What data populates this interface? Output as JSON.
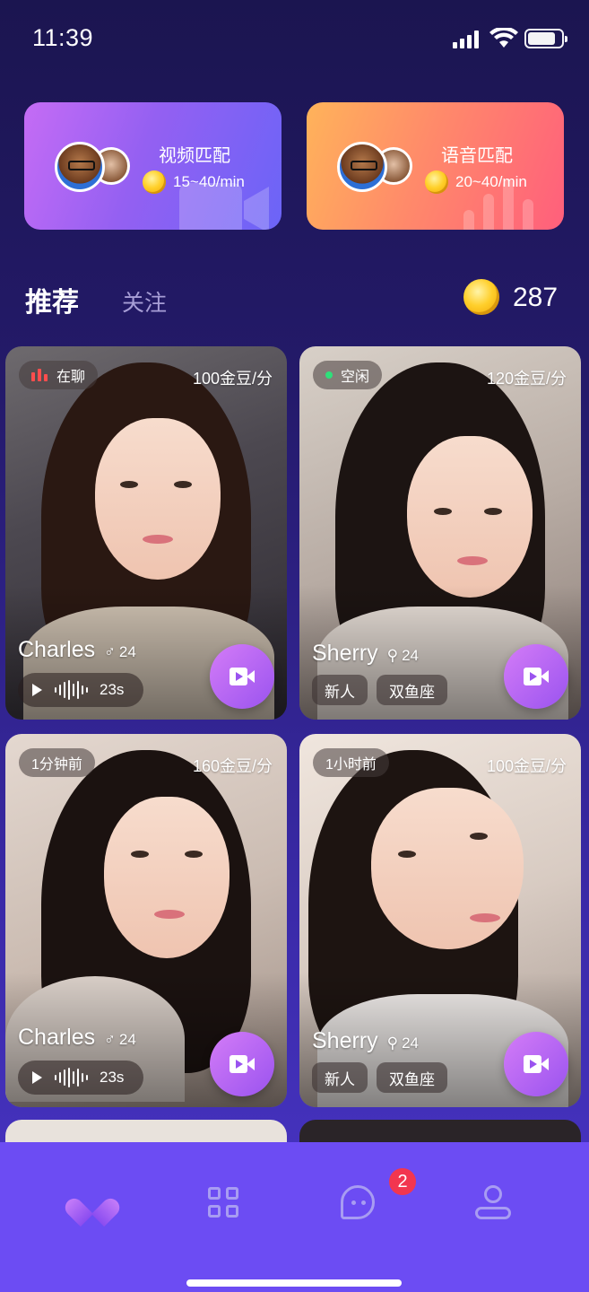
{
  "status_bar": {
    "time": "11:39"
  },
  "match_cards": [
    {
      "title": "视频匹配",
      "price": "15~40/min"
    },
    {
      "title": "语音匹配",
      "price": "20~40/min"
    }
  ],
  "tabs": {
    "recommend": "推荐",
    "follow": "关注"
  },
  "balance": {
    "value": "287"
  },
  "users": [
    {
      "status": "在聊",
      "status_type": "busy",
      "rate": "100金豆/分",
      "name": "Charles",
      "gender_icon": "male-icon",
      "gender_symbol": "♂",
      "age": "24",
      "voice_duration": "23s",
      "tags": []
    },
    {
      "status": "空闲",
      "status_type": "idle",
      "rate": "120金豆/分",
      "name": "Sherry",
      "gender_icon": "female-icon",
      "gender_symbol": "⚲",
      "age": "24",
      "tags": [
        "新人",
        "双鱼座"
      ]
    },
    {
      "status": "1分钟前",
      "status_type": "time",
      "rate": "160金豆/分",
      "name": "Charles",
      "gender_icon": "male-icon",
      "gender_symbol": "♂",
      "age": "24",
      "voice_duration": "23s",
      "tags": []
    },
    {
      "status": "1小时前",
      "status_type": "time",
      "rate": "100金豆/分",
      "name": "Sherry",
      "gender_icon": "female-icon",
      "gender_symbol": "⚲",
      "age": "24",
      "tags": [
        "新人",
        "双鱼座"
      ]
    }
  ],
  "bottom_nav": {
    "items": [
      "heart-icon",
      "grid-icon",
      "chat-icon",
      "profile-icon"
    ],
    "active": "heart-icon",
    "message_badge": "2"
  },
  "colors": {
    "accent": "#9a53ef",
    "nav_background": "#6c4cf3",
    "badge": "#f2364f",
    "online_dot": "#2ee07a",
    "busy_bars": "#ff4d4d"
  }
}
